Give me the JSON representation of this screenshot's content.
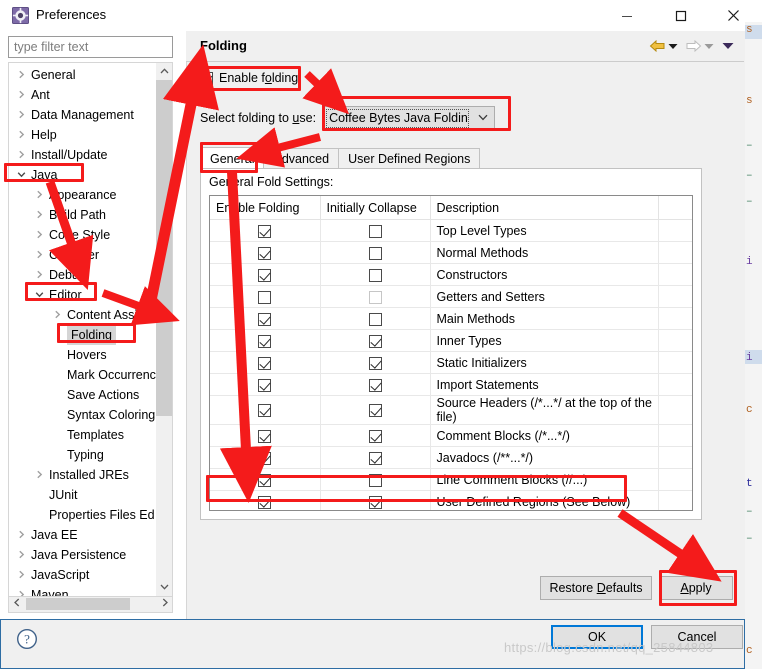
{
  "window": {
    "title": "Preferences",
    "icon": "preferences-gear-icon",
    "minimize_label": "—",
    "maximize_label": "□",
    "close_label": "✕"
  },
  "sidebar": {
    "filter": {
      "placeholder": "type filter text",
      "value": ""
    },
    "items": [
      {
        "label": "General",
        "indent": 0,
        "arrow": "collapsed",
        "selected": false
      },
      {
        "label": "Ant",
        "indent": 0,
        "arrow": "collapsed",
        "selected": false
      },
      {
        "label": "Data Management",
        "indent": 0,
        "arrow": "collapsed",
        "selected": false
      },
      {
        "label": "Help",
        "indent": 0,
        "arrow": "collapsed",
        "selected": false
      },
      {
        "label": "Install/Update",
        "indent": 0,
        "arrow": "collapsed",
        "selected": false
      },
      {
        "label": "Java",
        "indent": 0,
        "arrow": "expanded",
        "selected": false
      },
      {
        "label": "Appearance",
        "indent": 1,
        "arrow": "collapsed",
        "selected": false
      },
      {
        "label": "Build Path",
        "indent": 1,
        "arrow": "collapsed",
        "selected": false
      },
      {
        "label": "Code Style",
        "indent": 1,
        "arrow": "collapsed",
        "selected": false
      },
      {
        "label": "Compiler",
        "indent": 1,
        "arrow": "collapsed",
        "selected": false
      },
      {
        "label": "Debug",
        "indent": 1,
        "arrow": "collapsed",
        "selected": false
      },
      {
        "label": "Editor",
        "indent": 1,
        "arrow": "expanded",
        "selected": false
      },
      {
        "label": "Content Assist",
        "indent": 2,
        "arrow": "collapsed",
        "selected": false
      },
      {
        "label": "Folding",
        "indent": 2,
        "arrow": "none",
        "selected": true
      },
      {
        "label": "Hovers",
        "indent": 2,
        "arrow": "none",
        "selected": false
      },
      {
        "label": "Mark Occurrences",
        "indent": 2,
        "arrow": "none",
        "selected": false
      },
      {
        "label": "Save Actions",
        "indent": 2,
        "arrow": "none",
        "selected": false
      },
      {
        "label": "Syntax Coloring",
        "indent": 2,
        "arrow": "none",
        "selected": false
      },
      {
        "label": "Templates",
        "indent": 2,
        "arrow": "none",
        "selected": false
      },
      {
        "label": "Typing",
        "indent": 2,
        "arrow": "none",
        "selected": false
      },
      {
        "label": "Installed JREs",
        "indent": 1,
        "arrow": "collapsed",
        "selected": false
      },
      {
        "label": "JUnit",
        "indent": 1,
        "arrow": "none",
        "selected": false
      },
      {
        "label": "Properties Files Ed",
        "indent": 1,
        "arrow": "none",
        "selected": false
      },
      {
        "label": "Java EE",
        "indent": 0,
        "arrow": "collapsed",
        "selected": false
      },
      {
        "label": "Java Persistence",
        "indent": 0,
        "arrow": "collapsed",
        "selected": false
      },
      {
        "label": "JavaScript",
        "indent": 0,
        "arrow": "collapsed",
        "selected": false
      },
      {
        "label": "Maven",
        "indent": 0,
        "arrow": "collapsed",
        "selected": false
      }
    ],
    "scroll_up_icon": "chevron-up-icon",
    "scroll_down_icon": "chevron-down-icon",
    "scroll_left_icon": "chevron-left-icon",
    "scroll_right_icon": "chevron-right-icon"
  },
  "page": {
    "title": "Folding",
    "nav": {
      "back_icon": "back-arrow-icon",
      "back_menu_icon": "dropdown-caret-icon",
      "forward_icon": "forward-arrow-icon",
      "forward_menu_icon": "dropdown-caret-icon",
      "more_icon": "dropdown-caret-icon"
    },
    "enable_folding": {
      "label_pre": "Enable f",
      "label_mnemonic": "o",
      "label_post": "lding",
      "checked": true
    },
    "select_folding": {
      "label_pre": "Select folding to ",
      "label_mnemonic": "u",
      "label_post": "se:",
      "value": "Coffee Bytes Java Folding",
      "caret_icon": "chevron-down-icon"
    },
    "tabs": [
      {
        "label": "General",
        "active": true
      },
      {
        "label": "Advanced",
        "active": false
      },
      {
        "label": "User Defined Regions",
        "active": false
      }
    ],
    "settings_caption": "General Fold Settings:",
    "table": {
      "columns": [
        "Enable Folding",
        "Initially Collapse",
        "Description",
        ""
      ],
      "rows": [
        {
          "enable": true,
          "collapse": false,
          "collapse_disabled": false,
          "description": "Top Level Types"
        },
        {
          "enable": true,
          "collapse": false,
          "collapse_disabled": false,
          "description": "Normal Methods"
        },
        {
          "enable": true,
          "collapse": false,
          "collapse_disabled": false,
          "description": "Constructors"
        },
        {
          "enable": false,
          "collapse": false,
          "collapse_disabled": true,
          "description": "Getters and Setters"
        },
        {
          "enable": true,
          "collapse": false,
          "collapse_disabled": false,
          "description": "Main Methods"
        },
        {
          "enable": true,
          "collapse": true,
          "collapse_disabled": false,
          "description": "Inner Types"
        },
        {
          "enable": true,
          "collapse": true,
          "collapse_disabled": false,
          "description": "Static Initializers"
        },
        {
          "enable": true,
          "collapse": true,
          "collapse_disabled": false,
          "description": "Import Statements"
        },
        {
          "enable": true,
          "collapse": true,
          "collapse_disabled": false,
          "description": "Source Headers (/*...*/ at the top of the file)"
        },
        {
          "enable": true,
          "collapse": true,
          "collapse_disabled": false,
          "description": "Comment Blocks (/*...*/)"
        },
        {
          "enable": true,
          "collapse": true,
          "collapse_disabled": false,
          "description": "Javadocs (/**...*/)"
        },
        {
          "enable": true,
          "collapse": false,
          "collapse_disabled": false,
          "description": "Line Comment Blocks (//...)"
        },
        {
          "enable": true,
          "collapse": true,
          "collapse_disabled": false,
          "description": "User Defined Regions (See Below)"
        }
      ]
    }
  },
  "footer": {
    "restore_defaults": {
      "pre": "Restore ",
      "mnemonic": "D",
      "post": "efaults"
    },
    "apply": {
      "pre": "",
      "mnemonic": "A",
      "post": "pply"
    },
    "ok": "OK",
    "cancel": "Cancel",
    "help_icon": "help-question-icon"
  },
  "watermark": "https://blog.csdn.net/qq_25844803",
  "colors": {
    "annotation": "#f41b1b",
    "accent": "#0078d7",
    "selection": "#d5d5d5"
  }
}
